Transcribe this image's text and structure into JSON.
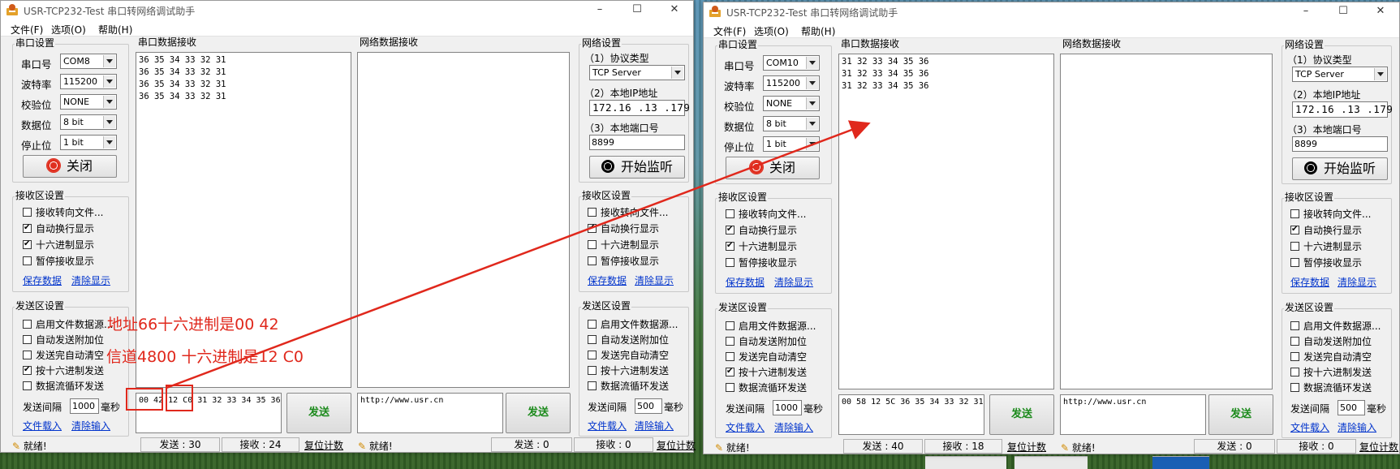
{
  "colors": {
    "annotation": "#e0281c",
    "send_green": "#1b8a1b",
    "link_blue": "#0033cc"
  },
  "windows": [
    {
      "title": "USR-TCP232-Test 串口转网络调试助手",
      "menu": [
        "文件(F)",
        "选项(O)",
        "帮助(H)"
      ],
      "serial_settings": {
        "title": "串口设置",
        "port_label": "串口号",
        "port_value": "COM8",
        "baud_label": "波特率",
        "baud_value": "115200",
        "parity_label": "校验位",
        "parity_value": "NONE",
        "databits_label": "数据位",
        "databits_value": "8 bit",
        "stopbits_label": "停止位",
        "stopbits_value": "1 bit",
        "close_button": "关闭"
      },
      "serial_recv": {
        "title": "串口数据接收",
        "content": "36 35 34 33 32 31\n36 35 34 33 32 31\n36 35 34 33 32 31\n36 35 34 33 32 31"
      },
      "net_recv": {
        "title": "网络数据接收",
        "content": ""
      },
      "net_settings": {
        "title": "网络设置",
        "protocol_label": "（1）协议类型",
        "protocol_value": "TCP Server",
        "ip_label": "（2）本地IP地址",
        "ip_value": "172.16 .13 .179",
        "port_label": "（3）本地端口号",
        "port_value": "8899",
        "listen_button": "开始监听"
      },
      "recv_settings_left": {
        "title": "接收区设置",
        "options": [
          {
            "label": "接收转向文件...",
            "checked": false
          },
          {
            "label": "自动换行显示",
            "checked": true
          },
          {
            "label": "十六进制显示",
            "checked": true
          },
          {
            "label": "暂停接收显示",
            "checked": false
          }
        ],
        "save_link": "保存数据",
        "clear_link": "清除显示"
      },
      "recv_settings_right": {
        "title": "接收区设置",
        "options": [
          {
            "label": "接收转向文件...",
            "checked": false
          },
          {
            "label": "自动换行显示",
            "checked": true
          },
          {
            "label": "十六进制显示",
            "checked": false
          },
          {
            "label": "暂停接收显示",
            "checked": false
          }
        ],
        "save_link": "保存数据",
        "clear_link": "清除显示"
      },
      "send_settings_left": {
        "title": "发送区设置",
        "options": [
          {
            "label": "启用文件数据源...",
            "checked": false
          },
          {
            "label": "自动发送附加位",
            "checked": false
          },
          {
            "label": "发送完自动清空",
            "checked": false
          },
          {
            "label": "按十六进制发送",
            "checked": true
          },
          {
            "label": "数据流循环发送",
            "checked": false
          }
        ],
        "interval_label": "发送间隔",
        "interval_value": "1000",
        "interval_unit": "毫秒",
        "load_link": "文件载入",
        "clear_link": "清除输入"
      },
      "send_settings_right": {
        "title": "发送区设置",
        "options": [
          {
            "label": "启用文件数据源...",
            "checked": false
          },
          {
            "label": "自动发送附加位",
            "checked": false
          },
          {
            "label": "发送完自动清空",
            "checked": false
          },
          {
            "label": "按十六进制发送",
            "checked": false
          },
          {
            "label": "数据流循环发送",
            "checked": false
          }
        ],
        "interval_label": "发送间隔",
        "interval_value": "500",
        "interval_unit": "毫秒",
        "load_link": "文件载入",
        "clear_link": "清除输入"
      },
      "serial_send_text": "00 42 12 C0 31 32 33 34 35 36",
      "net_send_text": "http://www.usr.cn",
      "send_button": "发送",
      "status": {
        "ready_left": "就绪!",
        "sent_left": "发送 : 30",
        "recv_left": "接收 : 24",
        "reset_left": "复位计数",
        "ready_right": "就绪!",
        "sent_right": "发送 : 0",
        "recv_right": "接收 : 0",
        "reset_right": "复位计数"
      }
    },
    {
      "title": "USR-TCP232-Test 串口转网络调试助手",
      "menu": [
        "文件(F)",
        "选项(O)",
        "帮助(H)"
      ],
      "serial_settings": {
        "title": "串口设置",
        "port_label": "串口号",
        "port_value": "COM10",
        "baud_label": "波特率",
        "baud_value": "115200",
        "parity_label": "校验位",
        "parity_value": "NONE",
        "databits_label": "数据位",
        "databits_value": "8 bit",
        "stopbits_label": "停止位",
        "stopbits_value": "1 bit",
        "close_button": "关闭"
      },
      "serial_recv": {
        "title": "串口数据接收",
        "content": "31 32 33 34 35 36\n31 32 33 34 35 36\n31 32 33 34 35 36"
      },
      "net_recv": {
        "title": "网络数据接收",
        "content": ""
      },
      "net_settings": {
        "title": "网络设置",
        "protocol_label": "（1）协议类型",
        "protocol_value": "TCP Server",
        "ip_label": "（2）本地IP地址",
        "ip_value": "172.16 .13 .179",
        "port_label": "（3）本地端口号",
        "port_value": "8899",
        "listen_button": "开始监听"
      },
      "recv_settings_left": {
        "title": "接收区设置",
        "options": [
          {
            "label": "接收转向文件...",
            "checked": false
          },
          {
            "label": "自动换行显示",
            "checked": true
          },
          {
            "label": "十六进制显示",
            "checked": true
          },
          {
            "label": "暂停接收显示",
            "checked": false
          }
        ],
        "save_link": "保存数据",
        "clear_link": "清除显示"
      },
      "recv_settings_right": {
        "title": "接收区设置",
        "options": [
          {
            "label": "接收转向文件...",
            "checked": false
          },
          {
            "label": "自动换行显示",
            "checked": true
          },
          {
            "label": "十六进制显示",
            "checked": false
          },
          {
            "label": "暂停接收显示",
            "checked": false
          }
        ],
        "save_link": "保存数据",
        "clear_link": "清除显示"
      },
      "send_settings_left": {
        "title": "发送区设置",
        "options": [
          {
            "label": "启用文件数据源...",
            "checked": false
          },
          {
            "label": "自动发送附加位",
            "checked": false
          },
          {
            "label": "发送完自动清空",
            "checked": false
          },
          {
            "label": "按十六进制发送",
            "checked": true
          },
          {
            "label": "数据流循环发送",
            "checked": false
          }
        ],
        "interval_label": "发送间隔",
        "interval_value": "1000",
        "interval_unit": "毫秒",
        "load_link": "文件载入",
        "clear_link": "清除输入"
      },
      "send_settings_right": {
        "title": "发送区设置",
        "options": [
          {
            "label": "启用文件数据源...",
            "checked": false
          },
          {
            "label": "自动发送附加位",
            "checked": false
          },
          {
            "label": "发送完自动清空",
            "checked": false
          },
          {
            "label": "按十六进制发送",
            "checked": false
          },
          {
            "label": "数据流循环发送",
            "checked": false
          }
        ],
        "interval_label": "发送间隔",
        "interval_value": "500",
        "interval_unit": "毫秒",
        "load_link": "文件载入",
        "clear_link": "清除输入"
      },
      "serial_send_text": "00 58 12 5C 36 35 34 33 32 31",
      "net_send_text": "http://www.usr.cn",
      "send_button": "发送",
      "status": {
        "ready_left": "就绪!",
        "sent_left": "发送 : 40",
        "recv_left": "接收 : 18",
        "reset_left": "复位计数",
        "ready_right": "就绪!",
        "sent_right": "发送 : 0",
        "recv_right": "接收 : 0",
        "reset_right": "复位计数"
      }
    }
  ],
  "annotations": {
    "line1": "地址66十六进制是00 42",
    "line2": "信道4800 十六进制是12 C0"
  }
}
